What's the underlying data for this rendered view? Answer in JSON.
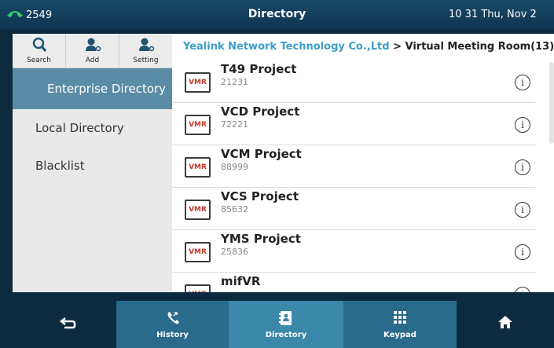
{
  "status": {
    "extension": "2549",
    "title": "Directory",
    "clock": "10 31 Thu, Nov 2"
  },
  "sidebar": {
    "tools": [
      {
        "label": "Search",
        "icon": "search-icon"
      },
      {
        "label": "Add",
        "icon": "add-contact-icon"
      },
      {
        "label": "Setting",
        "icon": "contact-settings-icon"
      }
    ],
    "items": [
      {
        "label": "Enterprise Directory",
        "active": true
      },
      {
        "label": "Local Directory",
        "active": false
      },
      {
        "label": "Blacklist",
        "active": false
      }
    ]
  },
  "breadcrumb": {
    "org": "Yealink Network Technology Co.,Ltd",
    "separator": " > ",
    "room": "Virtual Meeting Room(13)"
  },
  "list": [
    {
      "badge": "VMR",
      "name": "T49 Project",
      "number": "21231"
    },
    {
      "badge": "VMR",
      "name": "VCD Project",
      "number": "72221"
    },
    {
      "badge": "VMR",
      "name": "VCM Project",
      "number": "88999"
    },
    {
      "badge": "VMR",
      "name": "VCS Project",
      "number": "85632"
    },
    {
      "badge": "VMR",
      "name": "YMS Project",
      "number": "25836"
    },
    {
      "badge": "VMR",
      "name": "mifVR",
      "number": ""
    }
  ],
  "info_glyph": "i",
  "softkeys": {
    "back_icon": "back-arrow-icon",
    "history": "History",
    "directory": "Directory",
    "keypad": "Keypad",
    "home_icon": "home-icon"
  },
  "colors": {
    "accent": "#3d9ec7",
    "active_nav": "#5b8ca5",
    "softkey_active": "#3b88aa",
    "phone_green": "#2ecc71",
    "vmr_red": "#c0392b"
  }
}
